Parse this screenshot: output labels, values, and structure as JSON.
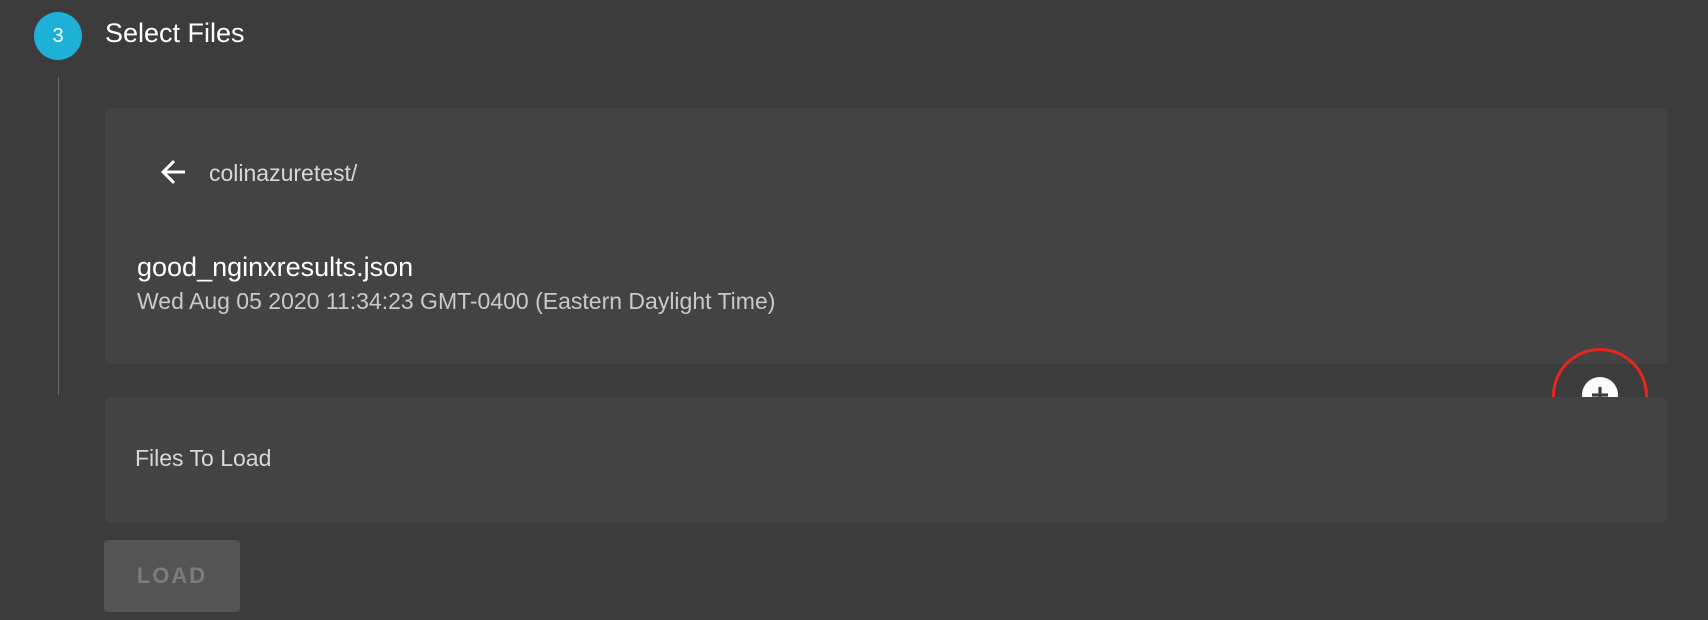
{
  "step": {
    "number": "3",
    "title": "Select Files"
  },
  "browser": {
    "back_icon": "arrow-left-icon",
    "path": "colinazuretest/",
    "files": [
      {
        "name": "good_nginxresults.json",
        "modified": "Wed Aug 05 2020 11:34:23 GMT-0400 (Eastern Daylight Time)",
        "action_icon": "plus-circle-icon"
      }
    ]
  },
  "files_to_load": {
    "title": "Files To Load"
  },
  "actions": {
    "load_label": "LOAD"
  },
  "colors": {
    "background": "#3c3c3c",
    "card": "#434343",
    "step_badge": "#1fb0d8",
    "highlight": "#e8261f",
    "disabled_button": "#545454"
  }
}
